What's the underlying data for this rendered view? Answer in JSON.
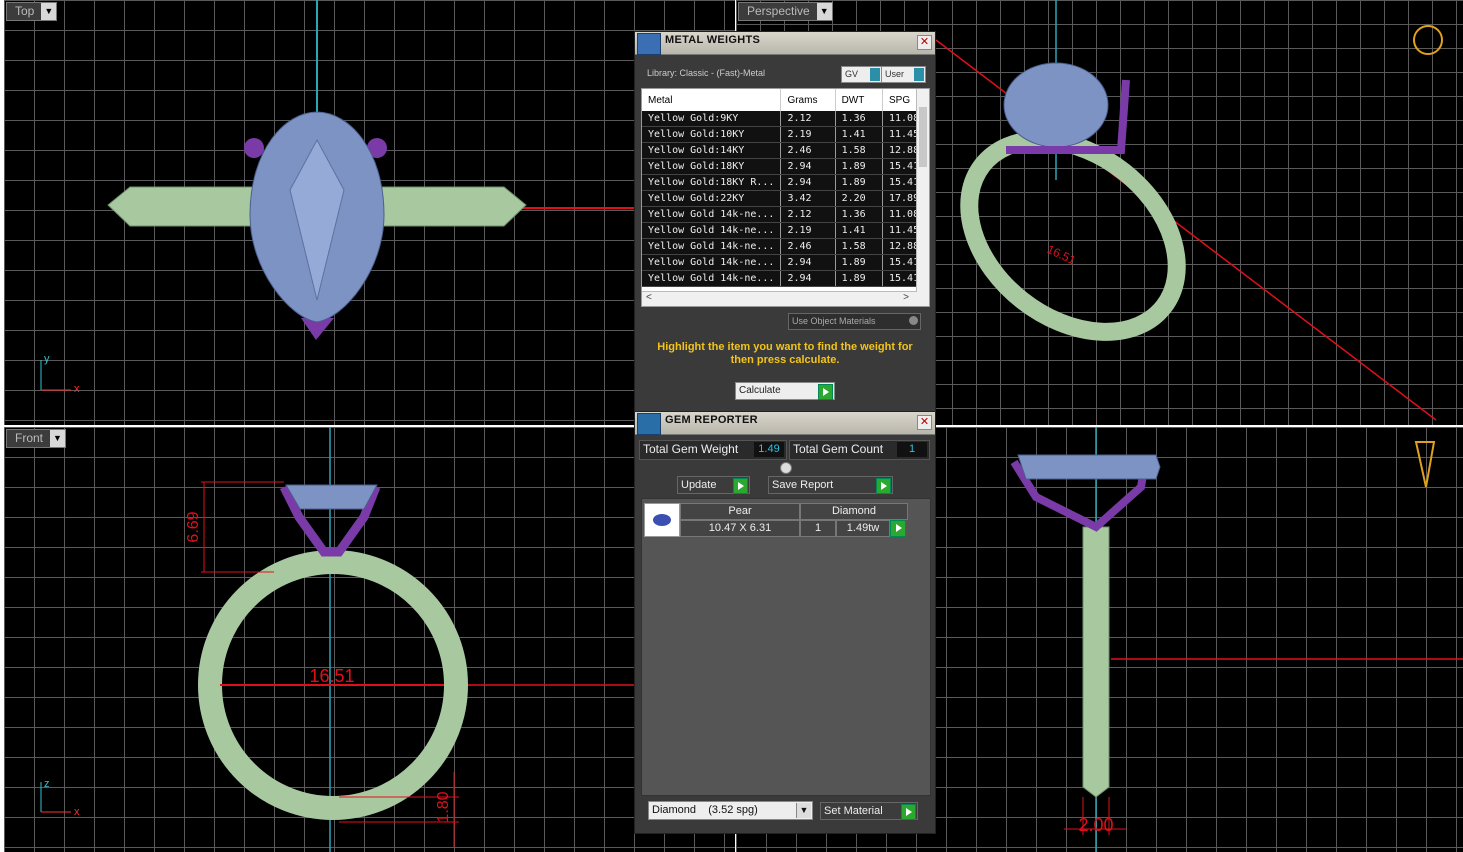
{
  "viewports": {
    "top": {
      "label": "Top",
      "axis_a": "y",
      "axis_b": "x"
    },
    "perspective": {
      "label": "Perspective",
      "dim": "16.51"
    },
    "front": {
      "label": "Front",
      "axis_a": "z",
      "axis_b": "x",
      "dim_height": "6.69",
      "dim_width": "16.51",
      "dim_thick": "1.80"
    },
    "side": {
      "dim_width": "2.00"
    }
  },
  "metal_weights": {
    "title": "METAL WEIGHTS",
    "library": "Library: Classic - (Fast)-Metal",
    "toggle_gv": "GV",
    "toggle_user": "User",
    "columns": [
      "Metal",
      "Grams",
      "DWT",
      "SPG"
    ],
    "rows": [
      [
        "Yellow Gold:9KY",
        "2.12",
        "1.36",
        "11.08"
      ],
      [
        "Yellow Gold:10KY",
        "2.19",
        "1.41",
        "11.45"
      ],
      [
        "Yellow Gold:14KY",
        "2.46",
        "1.58",
        "12.88"
      ],
      [
        "Yellow Gold:18KY",
        "2.94",
        "1.89",
        "15.41"
      ],
      [
        "Yellow Gold:18KY R...",
        "2.94",
        "1.89",
        "15.41"
      ],
      [
        "Yellow Gold:22KY",
        "3.42",
        "2.20",
        "17.89"
      ],
      [
        "Yellow Gold 14k-ne...",
        "2.12",
        "1.36",
        "11.08"
      ],
      [
        "Yellow Gold 14k-ne...",
        "2.19",
        "1.41",
        "11.45"
      ],
      [
        "Yellow Gold 14k-ne...",
        "2.46",
        "1.58",
        "12.88"
      ],
      [
        "Yellow Gold 14k-ne...",
        "2.94",
        "1.89",
        "15.41"
      ],
      [
        "Yellow Gold 14k-ne...",
        "2.94",
        "1.89",
        "15.41"
      ]
    ],
    "use_object_materials": "Use Object Materials",
    "hint": "Highlight the item you want to find the weight for then press calculate.",
    "calculate": "Calculate"
  },
  "gem_reporter": {
    "title": "GEM REPORTER",
    "total_weight_label": "Total Gem Weight",
    "total_weight": "1.49",
    "total_count_label": "Total Gem Count",
    "total_count": "1",
    "update": "Update",
    "save_report": "Save Report",
    "gem": {
      "shape": "Pear",
      "type": "Diamond",
      "size": "10.47 X 6.31",
      "count": "1",
      "weight": "1.49tw"
    },
    "material_select": "Diamond    (3.52 spg)",
    "set_material": "Set Material"
  },
  "colors": {
    "band": "#a8c8a0",
    "gem": "#7d93c4",
    "prong": "#7a3aa8",
    "dim": "#e0101a",
    "axis": "#2aa6b8"
  }
}
